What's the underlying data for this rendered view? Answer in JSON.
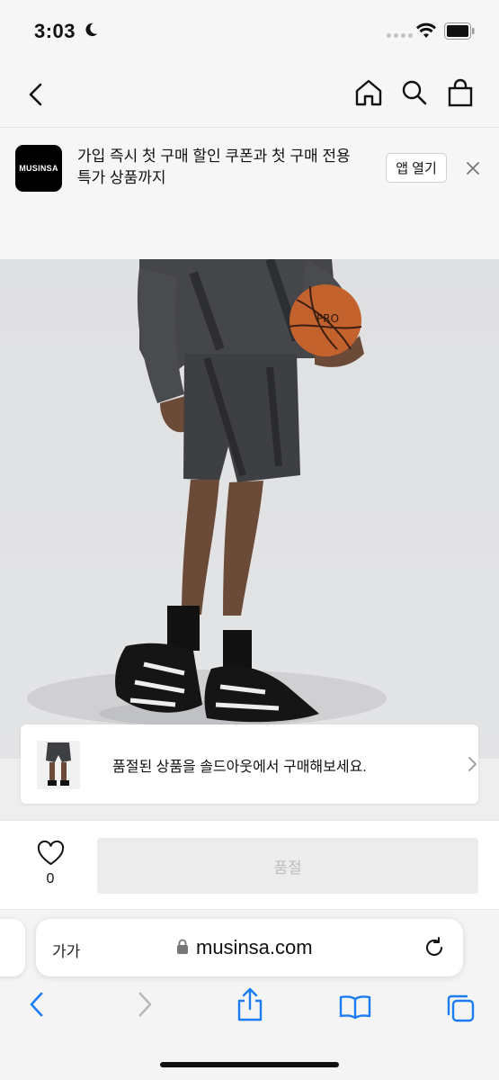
{
  "status_bar": {
    "time": "3:03"
  },
  "promo": {
    "logo_text": "MUSINSA",
    "message": "가입 즉시 첫 구매 할인 쿠폰과 첫 구매 전용 특가 상품까지",
    "open_app_label": "앱 열기"
  },
  "soldout_banner": {
    "text": "품절된 상품을 솔드아웃에서 구매해보세요."
  },
  "purchase_bar": {
    "like_count": "0",
    "soldout_label": "품절"
  },
  "safari": {
    "text_size_label": "가가",
    "url": "musinsa.com"
  },
  "colors": {
    "shorts": "#3e3f42",
    "ball": "#c4622d",
    "banner_bg": "#f6f6f6",
    "safari_blue": "#1b7cf2"
  }
}
